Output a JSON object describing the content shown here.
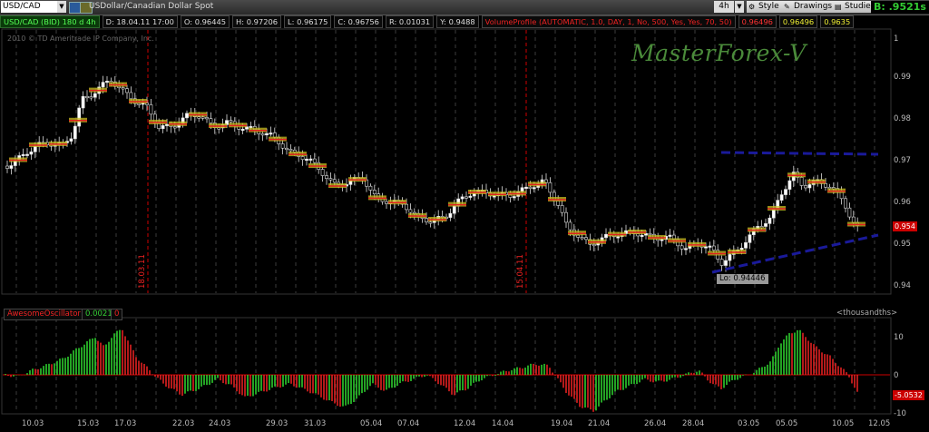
{
  "toolbar": {
    "symbol": "USD/CAD",
    "description": "USDollar/Canadian Dollar Spot",
    "timeframe": "4h",
    "style_label": "Style",
    "drawings_label": "Drawings",
    "studies_label": "Studies",
    "bid": "B: .9521s"
  },
  "info": {
    "symbol": "USD/CAD (BID) 180 d 4h",
    "date": "D: 18.04.11 17:00",
    "open": "O: 0.96445",
    "high": "H: 0.97206",
    "low": "L: 0.96175",
    "close": "C: 0.96756",
    "range": "R: 0.01031",
    "y": "Y: 0.9488",
    "volume_profile": "VolumeProfile (AUTOMATIC, 1.0, DAY, 1, No, 500, Yes, Yes, 70, 50)",
    "vp1": "0.96496",
    "vp2": "0.96496",
    "vp3": "0.9635"
  },
  "copyright": "2010 © TD Ameritrade IP Company, Inc.",
  "watermark": "MasterForex-V",
  "price_axis": [
    "1",
    "0.99",
    "0.98",
    "0.97",
    "0.96",
    "0.95",
    "0.94"
  ],
  "current_price_tag": "0.954",
  "low_label": "Lo: 0.94446",
  "vertical_markers": [
    "18.03.11",
    "15.04.11"
  ],
  "oscillator": {
    "name": "AwesomeOscillator",
    "value": "0.0021",
    "value2": "0",
    "units": "<thousandths>",
    "axis": [
      "10",
      "0",
      "-10"
    ],
    "current_tag": "-5.0532"
  },
  "x_axis": [
    "10.03",
    "15.03",
    "17.03",
    "22.03",
    "24.03",
    "29.03",
    "31.03",
    "05.04",
    "07.04",
    "12.04",
    "14.04",
    "19.04",
    "21.04",
    "26.04",
    "28.04",
    "03.05",
    "05.05",
    "10.05",
    "12.05"
  ],
  "colors": {
    "bull": "#2ecc2e",
    "bear": "#e02020",
    "trendline": "#1a1a9a",
    "watermark": "#4a8a3a"
  }
}
